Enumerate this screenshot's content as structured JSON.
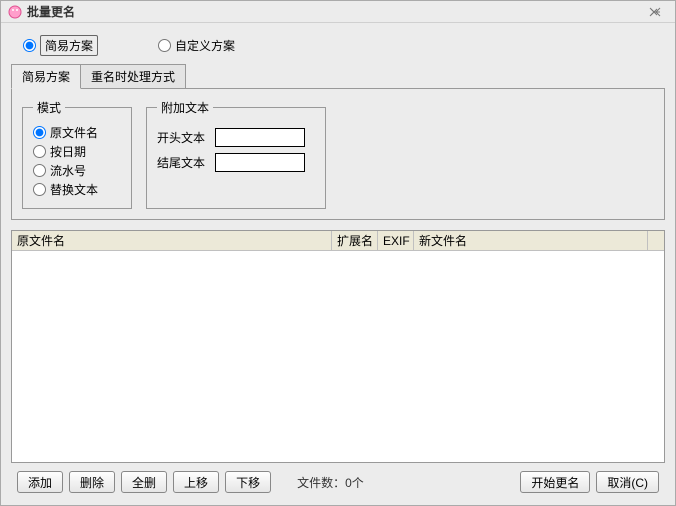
{
  "window": {
    "title": "批量更名"
  },
  "scheme": {
    "simple": "简易方案",
    "custom": "自定义方案",
    "selected": "simple"
  },
  "tabs": {
    "simple": "简易方案",
    "duplicate": "重名时处理方式"
  },
  "mode_group": {
    "legend": "模式",
    "options": {
      "original": "原文件名",
      "bydate": "按日期",
      "serial": "流水号",
      "replace": "替换文本"
    },
    "selected": "original"
  },
  "append_group": {
    "legend": "附加文本",
    "prefix_label": "开头文本",
    "suffix_label": "结尾文本",
    "prefix_value": "",
    "suffix_value": ""
  },
  "table": {
    "headers": {
      "original": "原文件名",
      "ext": "扩展名",
      "exif": "EXIF",
      "newname": "新文件名"
    },
    "rows": []
  },
  "status": {
    "file_count_label": "文件数：0个"
  },
  "buttons": {
    "add": "添加",
    "remove": "删除",
    "remove_all": "全删",
    "move_up": "上移",
    "move_down": "下移",
    "start": "开始更名",
    "cancel": "取消(C)"
  }
}
